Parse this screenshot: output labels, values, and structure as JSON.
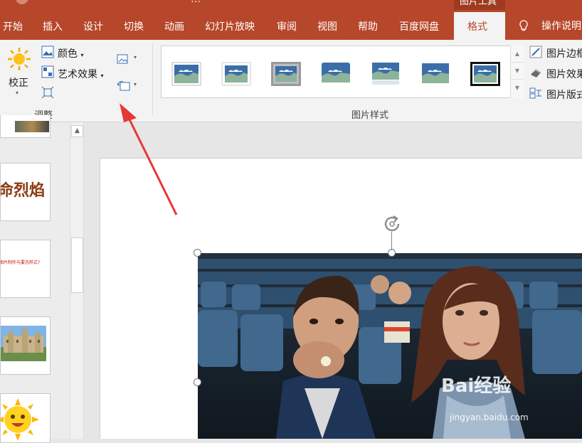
{
  "window": {
    "title_fragment": "…"
  },
  "context_tab_group": {
    "label": "图片工具"
  },
  "tabs": [
    {
      "label": "开始"
    },
    {
      "label": "插入"
    },
    {
      "label": "设计"
    },
    {
      "label": "切换"
    },
    {
      "label": "动画"
    },
    {
      "label": "幻灯片放映"
    },
    {
      "label": "审阅"
    },
    {
      "label": "视图"
    },
    {
      "label": "帮助"
    },
    {
      "label": "百度网盘"
    }
  ],
  "active_tab": {
    "label": "格式"
  },
  "tell_me": {
    "label": "操作说明"
  },
  "ribbon": {
    "adjust": {
      "correct": "校正",
      "color": "颜色",
      "artistic": "艺术效果",
      "group_label": "调整"
    },
    "styles": {
      "group_label": "图片样式",
      "border": "图片边框",
      "effects": "图片效果",
      "layout": "图片版式"
    }
  },
  "slides": {
    "slide2_text": "命烈焰",
    "slide3_text": "图片制作与要怎样式?"
  },
  "watermark": {
    "brand": "Bai经验",
    "url": "jingyan.baidu.com"
  },
  "colors": {
    "accent": "#b7472a",
    "ribbon_bg": "#f3f3f3",
    "arrow": "#e53935"
  }
}
